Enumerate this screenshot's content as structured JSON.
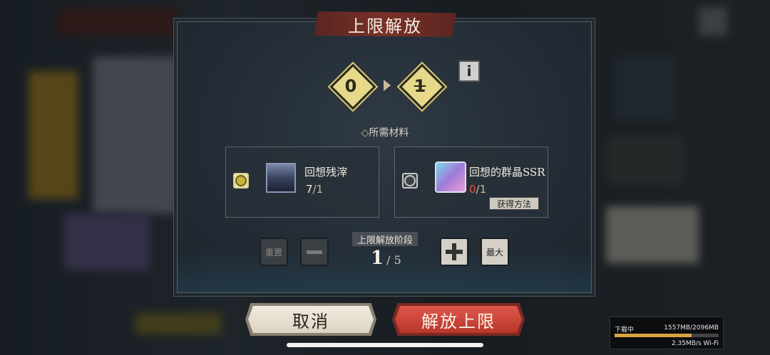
{
  "dialog": {
    "title": "上限解放"
  },
  "level": {
    "from": "0",
    "to": "1"
  },
  "materials": {
    "label": "所需材料",
    "items": [
      {
        "name": "回想残滓",
        "owned": "7",
        "required": "1",
        "selected": true,
        "count_color": "#f0ece2",
        "slash": "/"
      },
      {
        "name": "回想的群晶SSR",
        "owned": "0",
        "required": "1",
        "selected": false,
        "count_color": "#e0524a",
        "slash": "/",
        "obtain_label": "获得方法"
      }
    ]
  },
  "stage": {
    "label": "上限解放阶段",
    "current": "1",
    "max": "/ 5",
    "reset_label": "重置",
    "max_label": "最大"
  },
  "buttons": {
    "cancel": "取消",
    "confirm": "解放上限"
  },
  "download": {
    "status": "下载中",
    "progress_text": "1557MB/2096MB",
    "progress": 0.743,
    "speed": "2.35MB/s Wi-Fi"
  },
  "colors": {
    "accent_gold": "#e6d98a",
    "confirm_red": "#d4483a",
    "cancel_cream": "#e7e0d0"
  }
}
